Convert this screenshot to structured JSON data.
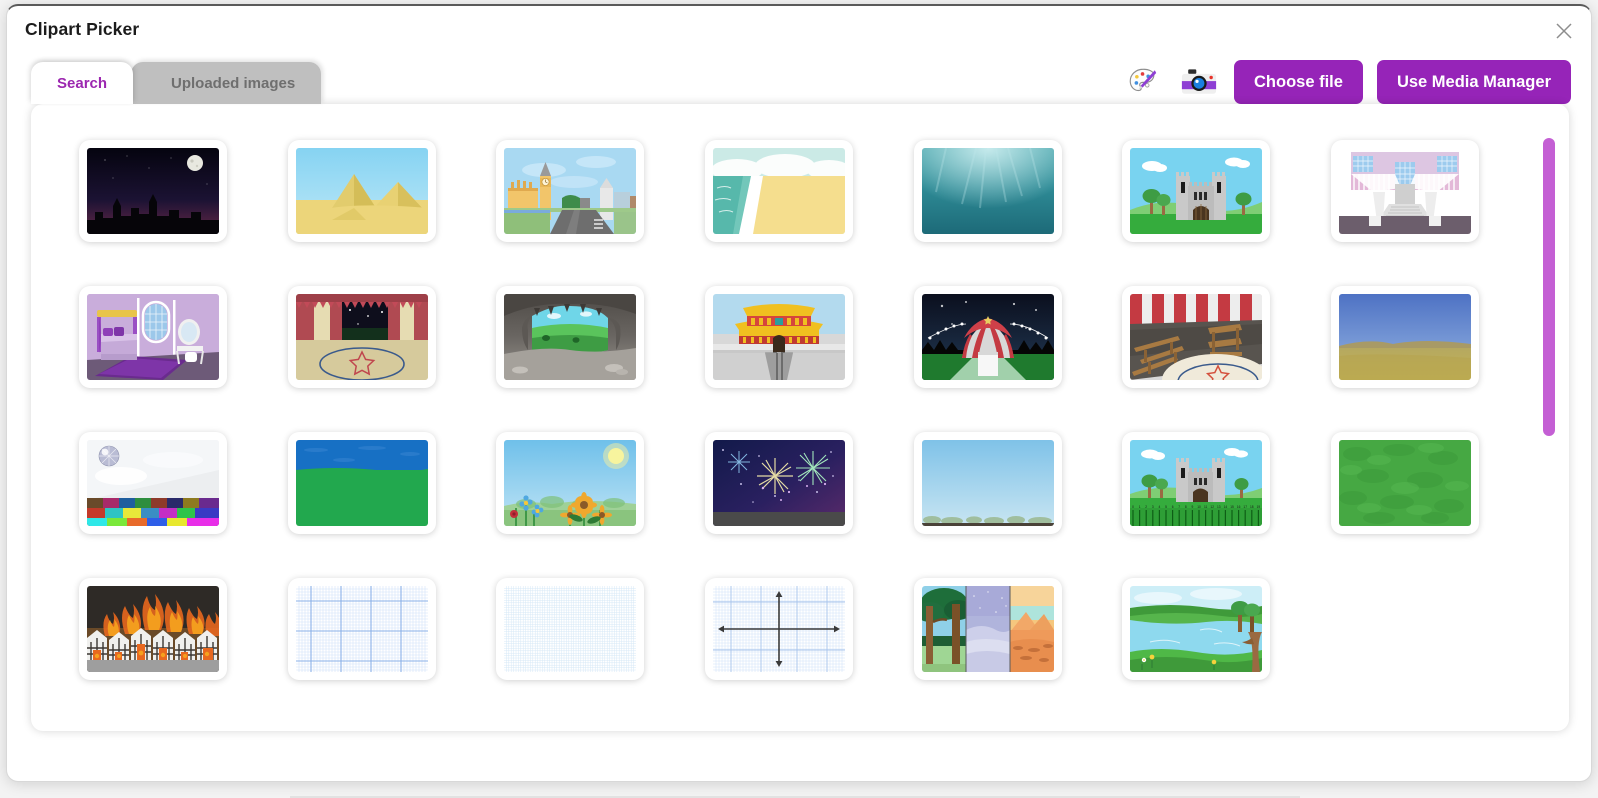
{
  "dialog": {
    "title": "Clipart Picker",
    "close_icon": "close-icon"
  },
  "tabs": [
    {
      "id": "search",
      "label": "Search",
      "active": true
    },
    {
      "id": "uploaded",
      "label": "Uploaded images",
      "active": false
    }
  ],
  "toolbar": {
    "palette_icon": "palette-icon",
    "camera_icon": "camera-icon",
    "choose_file_label": "Choose file",
    "media_manager_label": "Use Media Manager"
  },
  "colors": {
    "accent_purple": "#9624b8",
    "tab_active_text": "#9c27b0",
    "tab_inactive_bg": "#bfbfbf",
    "tab_inactive_text": "#6f6f6f",
    "scrollbar_thumb": "#c45fd4",
    "panel_bg": "#ffffff"
  },
  "scrollbar": {
    "orientation": "vertical",
    "thumb_position_percent": 4,
    "thumb_size_percent": 49
  },
  "gallery": {
    "columns": 7,
    "rows": 4,
    "items": [
      {
        "id": 1,
        "name": "night-city-skyline",
        "alt": "Night city skyline with moon"
      },
      {
        "id": 2,
        "name": "pyramids-desert",
        "alt": "Egyptian pyramids in desert"
      },
      {
        "id": 3,
        "name": "big-ben-london-street",
        "alt": "Big Ben and London street"
      },
      {
        "id": 4,
        "name": "beach-shoreline",
        "alt": "Sandy beach with waves"
      },
      {
        "id": 5,
        "name": "underwater-ocean",
        "alt": "Underwater ocean scene"
      },
      {
        "id": 6,
        "name": "castle-green-hills",
        "alt": "Stone castle on green hills"
      },
      {
        "id": 7,
        "name": "grand-staircase-hall",
        "alt": "Grand palace staircase"
      },
      {
        "id": 8,
        "name": "princess-bedroom",
        "alt": "Purple princess bedroom"
      },
      {
        "id": 9,
        "name": "circus-stage-ring",
        "alt": "Circus stage with star ring"
      },
      {
        "id": 10,
        "name": "cave-interior",
        "alt": "Cave interior looking out"
      },
      {
        "id": 11,
        "name": "chinese-palace",
        "alt": "Chinese palace gate"
      },
      {
        "id": 12,
        "name": "circus-tent-night",
        "alt": "Circus tent at night"
      },
      {
        "id": 13,
        "name": "circus-bleachers",
        "alt": "Circus interior with benches"
      },
      {
        "id": 14,
        "name": "savanna-plains",
        "alt": "Savanna grassland plains"
      },
      {
        "id": 15,
        "name": "disco-dance-floor",
        "alt": "Disco floor with mirror ball"
      },
      {
        "id": 16,
        "name": "sky-grass-simple",
        "alt": "Blue sky over green field"
      },
      {
        "id": 17,
        "name": "flower-meadow-sun",
        "alt": "Flower meadow with sun"
      },
      {
        "id": 18,
        "name": "fireworks-night",
        "alt": "Fireworks in night sky"
      },
      {
        "id": 19,
        "name": "plain-blue-sky",
        "alt": "Plain blue sky with horizon"
      },
      {
        "id": 20,
        "name": "castle-number-line",
        "alt": "Castle with number line 0 to 19"
      },
      {
        "id": 21,
        "name": "grass-texture",
        "alt": "Green grass texture"
      },
      {
        "id": 22,
        "name": "great-fire-of-london",
        "alt": "Tudor houses on fire"
      },
      {
        "id": 23,
        "name": "graph-paper-major-grid",
        "alt": "Graph paper with major grid"
      },
      {
        "id": 24,
        "name": "graph-paper-fine-grid",
        "alt": "Fine grid graph paper"
      },
      {
        "id": 25,
        "name": "coordinate-axes-grid",
        "alt": "Coordinate axes on graph paper"
      },
      {
        "id": 26,
        "name": "three-habitats-panels",
        "alt": "Forest, arctic and desert habitats"
      },
      {
        "id": 27,
        "name": "lake-riverbank",
        "alt": "Lake with grassy riverbank"
      }
    ]
  }
}
